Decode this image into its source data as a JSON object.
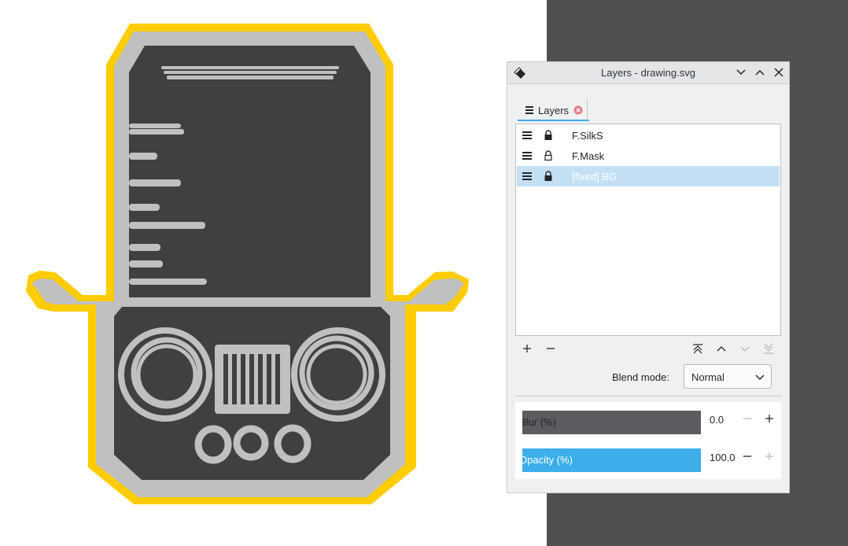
{
  "dialog": {
    "title": "Layers - drawing.svg",
    "tab": {
      "label": "Layers"
    }
  },
  "layers": [
    {
      "name": "F.SilkS",
      "locked": true,
      "selected": false
    },
    {
      "name": "F.Mask",
      "locked": false,
      "selected": false
    },
    {
      "name": "[fixed] BG",
      "locked": true,
      "selected": true
    }
  ],
  "blend_mode": {
    "label": "Blend mode:",
    "value": "Normal"
  },
  "blur": {
    "label": "Blur (%)",
    "value": "0.0",
    "fraction": 0
  },
  "opacity": {
    "label": "Opacity (%)",
    "value": "100.0",
    "fraction": 1.0
  },
  "colors": {
    "accent": "#3daee9",
    "selection": "#c4e0f5",
    "board_outline": "#ffcc00",
    "board_fill": "#404040",
    "silk": "#c0c0c0",
    "background_dark": "#4f4f4f",
    "blur_track": "#5a5c5f"
  }
}
